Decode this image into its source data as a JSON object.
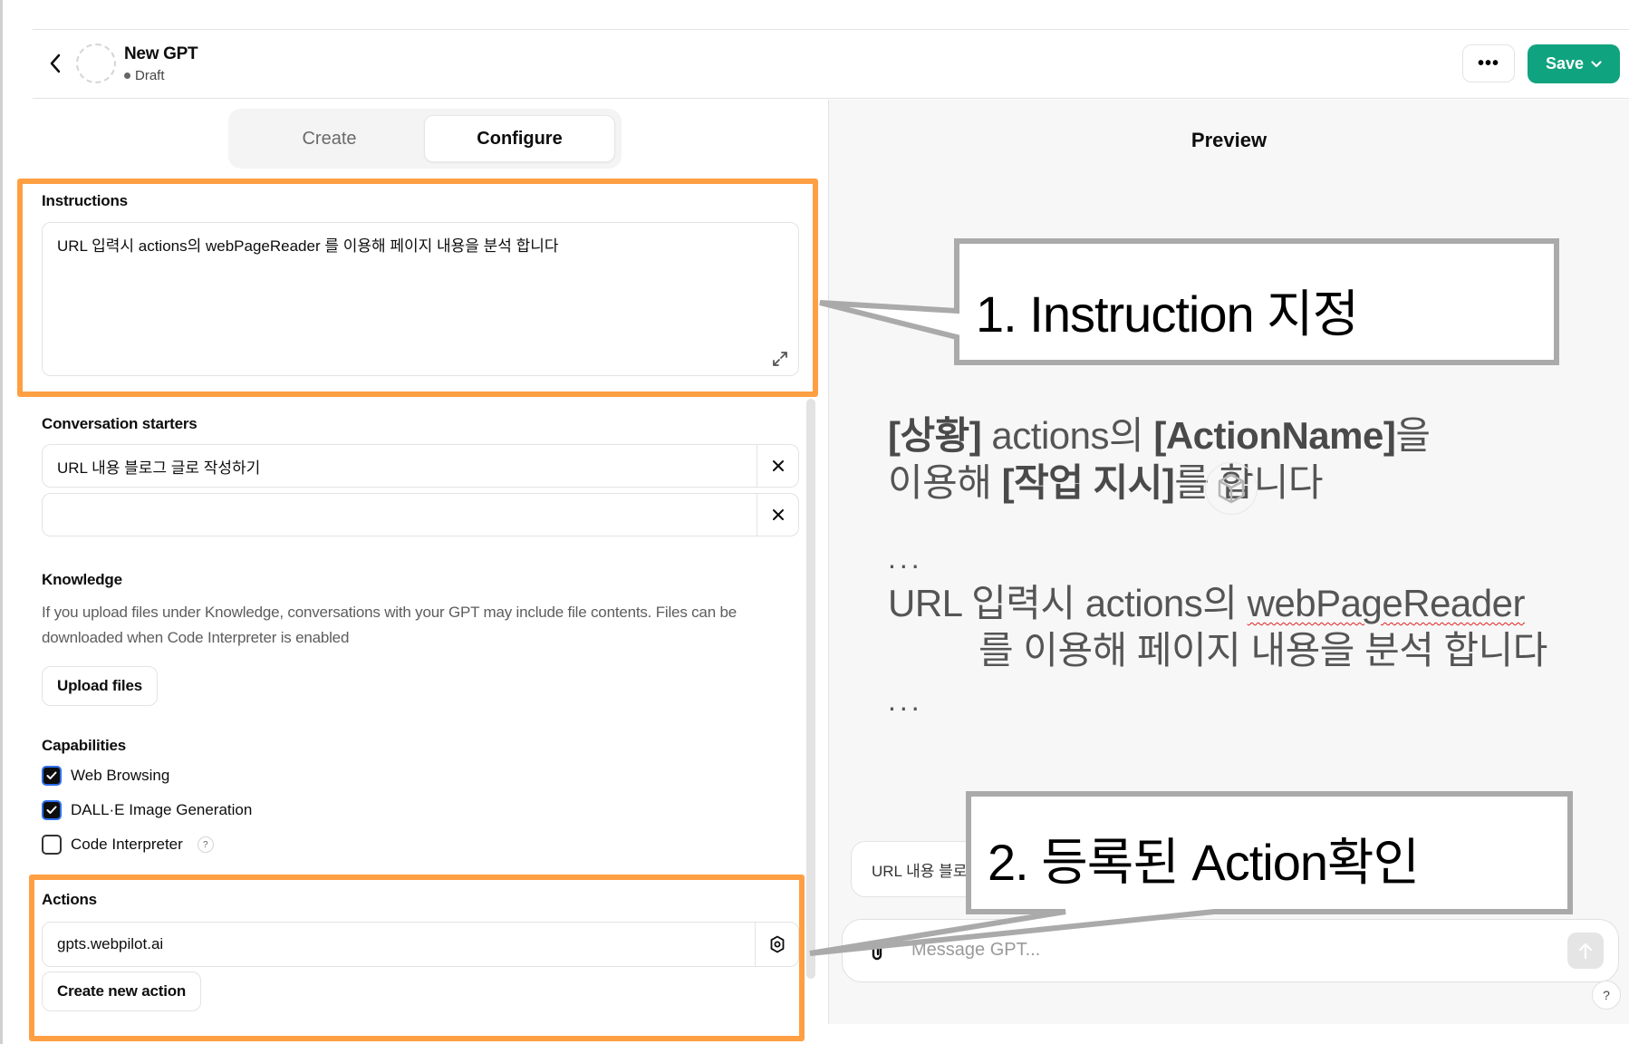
{
  "header": {
    "title": "New GPT",
    "status": "Draft",
    "more_label": "•••",
    "save_label": "Save"
  },
  "tabs": [
    {
      "label": "Create",
      "active": false
    },
    {
      "label": "Configure",
      "active": true
    }
  ],
  "instructions": {
    "label": "Instructions",
    "value": "URL 입력시 actions의 webPageReader 를 이용해 페이지 내용을 분석 합니다"
  },
  "conversation_starters": {
    "label": "Conversation starters",
    "items": [
      "URL 내용 블로그 글로 작성하기",
      ""
    ]
  },
  "knowledge": {
    "label": "Knowledge",
    "help": "If you upload files under Knowledge, conversations with your GPT may include file contents. Files can be downloaded when Code Interpreter is enabled",
    "upload_label": "Upload files"
  },
  "capabilities": {
    "label": "Capabilities",
    "items": [
      {
        "label": "Web Browsing",
        "checked": true
      },
      {
        "label": "DALL·E Image Generation",
        "checked": true
      },
      {
        "label": "Code Interpreter",
        "checked": false,
        "help": "?"
      }
    ]
  },
  "actions": {
    "label": "Actions",
    "items": [
      "gpts.webpilot.ai"
    ],
    "create_label": "Create new action"
  },
  "preview": {
    "title": "Preview",
    "overlay": {
      "line1_bold1": "[상황]",
      "line1_text1": " actions의 ",
      "line1_bold2": "[ActionName]",
      "line1_text2": "을",
      "line2_text1": "이용해 ",
      "line2_bold1": "[작업 지시]",
      "line2_text2": "를 합니다",
      "ellipsis": "...",
      "example_line1_a": "URL 입력시 actions의 ",
      "example_line1_b": "webPageReader",
      "example_line2": "를 이용해 페이지 내용을 분석 합니다"
    },
    "starter_chip": "URL 내용 블로그 글로 작성하기",
    "message_placeholder": "Message GPT...",
    "help": "?"
  },
  "callouts": [
    {
      "label": "1. Instruction 지정"
    },
    {
      "label": "2. 등록된 Action확인"
    }
  ],
  "colors": {
    "accent_green": "#10a37f",
    "highlight_orange": "#ff9f43",
    "callout_border": "#aaaaaa"
  }
}
